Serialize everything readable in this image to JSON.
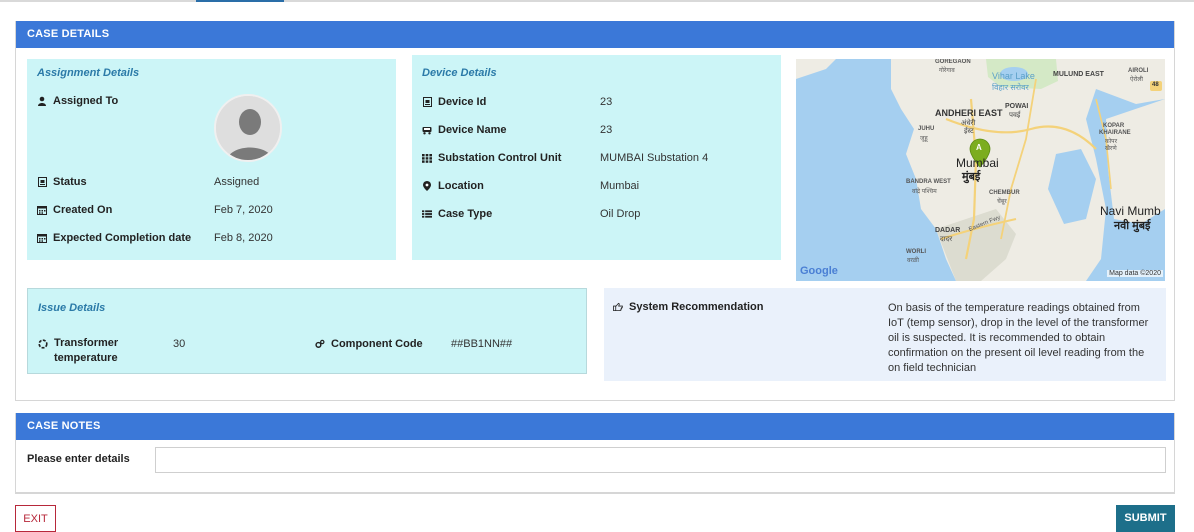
{
  "case_details": {
    "header": "CASE DETAILS",
    "assignment": {
      "title": "Assignment Details",
      "assigned_to_label": "Assigned To",
      "status_label": "Status",
      "status_value": "Assigned",
      "created_on_label": "Created On",
      "created_on_value": "Feb 7, 2020",
      "expected_label": "Expected Completion date",
      "expected_value": "Feb 8, 2020"
    },
    "device": {
      "title": "Device Details",
      "device_id_label": "Device Id",
      "device_id_value": "23",
      "device_name_label": "Device Name",
      "device_name_value": "23",
      "scu_label": "Substation Control Unit",
      "scu_value": "MUMBAI Substation 4",
      "location_label": "Location",
      "location_value": "Mumbai",
      "case_type_label": "Case Type",
      "case_type_value": "Oil Drop"
    },
    "map": {
      "labels": {
        "goregaon": "GOREGAON",
        "goregaon_local": "गोरेगाव",
        "vihar_lake": "Vihar Lake",
        "vihar_lake_local": "विहार सरोवर",
        "mulund_east": "MULUND EAST",
        "airoli": "AIROLI",
        "airoli_local": "ऐरोली",
        "andheri_east": "ANDHERI EAST",
        "andheri_east_local": "अंधेरी",
        "andheri_east_local2": "ईस्ट",
        "powai": "POWAI",
        "powai_local": "पवई",
        "juhu": "JUHU",
        "juhu_local": "जुहू",
        "kopar": "KOPAR",
        "khairane": "KHAIRANE",
        "khairane_local": "कोपर",
        "khairane_local2": "खैरणे",
        "mumbai": "Mumbai",
        "mumbai_local": "मुंबई",
        "bandra_west": "BANDRA WEST",
        "bandra_west_local": "वांद्रे पश्चिम",
        "chembur": "CHEMBUR",
        "chembur_local": "चेंबूर",
        "navi_mumbai": "Navi Mumb",
        "navi_mumbai_local": "नवी मुंबई",
        "dadar": "DADAR",
        "dadar_local": "दादर",
        "worli": "WORLI",
        "worli_local": "वरळी",
        "eastern_fwy": "Eastern Fwy",
        "highway_shield": "48",
        "marker": "A",
        "google": "Google",
        "attribution": "Map data ©2020"
      }
    },
    "issue": {
      "title": "Issue Details",
      "transformer_label": "Transformer temperature",
      "transformer_value": "30",
      "component_label": "Component Code",
      "component_value": "##BB1NN##"
    },
    "recommendation": {
      "label": "System Recommendation",
      "text": "On basis of the temperature readings obtained from IoT (temp sensor), drop in the level of the transformer oil is suspected. It is recommended to obtain confirmation on the present oil level reading from the on field technician"
    }
  },
  "case_notes": {
    "header": "CASE NOTES",
    "label": "Please enter details",
    "input_value": "",
    "input_placeholder": ""
  },
  "actions": {
    "exit_label": "EXIT",
    "submit_label": "SUBMIT"
  },
  "icons": {
    "assigned_to": "user-icon",
    "status": "badge-icon",
    "created_on": "calendar-icon",
    "expected": "calendar-icon",
    "device_id": "id-card-icon",
    "device_name": "truck-icon",
    "scu": "grid-icon",
    "location": "map-marker-icon",
    "case_type": "list-icon",
    "transformer": "circle-notch-icon",
    "component": "cogs-icon",
    "recommendation": "hand-pointer-icon"
  },
  "colors": {
    "header_blue": "#3b78d8",
    "card_cyan": "#ccf5f7",
    "title_teal": "#2b7aa8",
    "recommendation_bg": "#eaf1fb",
    "exit_red": "#b7283a",
    "submit_teal": "#1d6f8a",
    "map_marker": "#7cad1f"
  }
}
